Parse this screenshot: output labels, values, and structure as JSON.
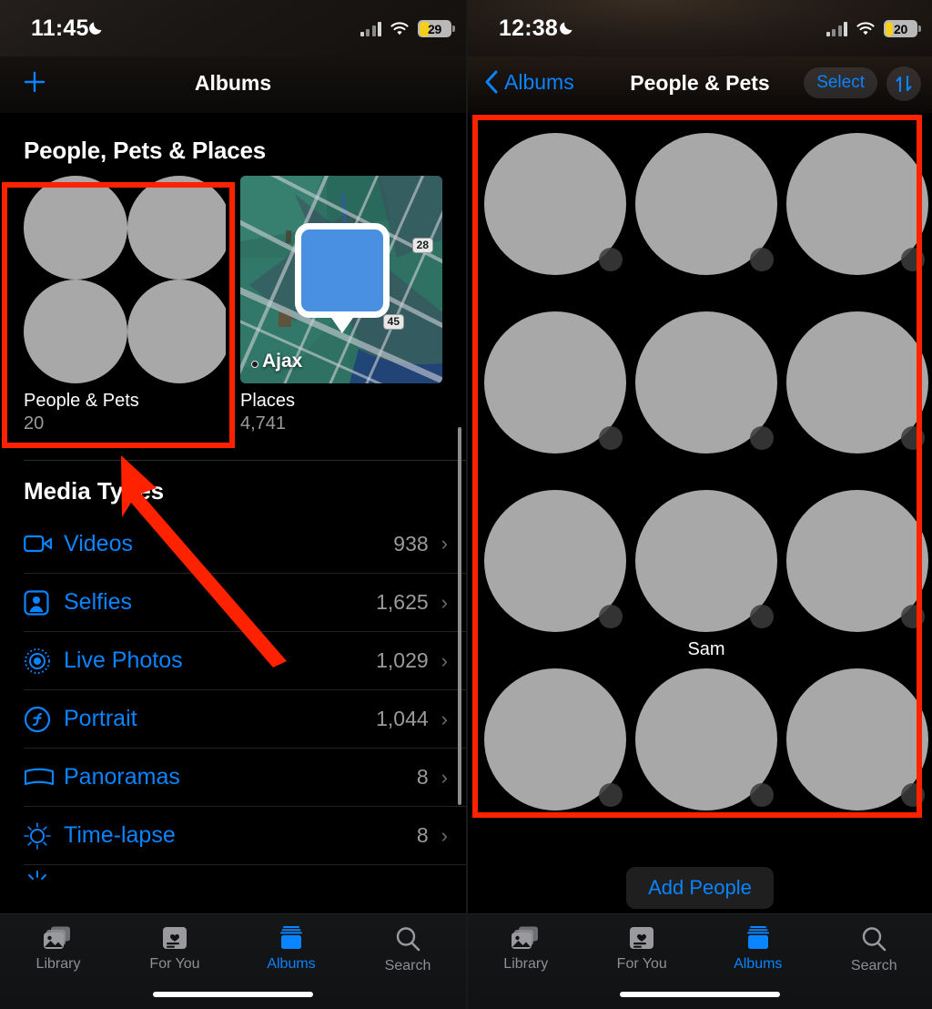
{
  "colors": {
    "accent_blue": "#0a84ff",
    "annotation_red": "#ff2200",
    "battery_yellow": "#f5cf1d",
    "background": "#000000"
  },
  "left_screen": {
    "status_bar": {
      "time": "11:45",
      "dnd_icon": "crescent-moon-icon",
      "battery_percent": "29",
      "wifi_icon": "wifi-icon",
      "cellular_icon": "cellular-bars-icon"
    },
    "nav": {
      "add_label": "+",
      "title": "Albums"
    },
    "section_people_places": {
      "heading": "People, Pets & Places",
      "cards": [
        {
          "name": "People & Pets",
          "count": "20",
          "art": "four-face-circles"
        },
        {
          "name": "Places",
          "count": "4,741",
          "art": "map-thumbnail"
        }
      ]
    },
    "map_thumb": {
      "city_label": "Ajax",
      "shield_1": "28",
      "shield_2": "45"
    },
    "section_media_types": {
      "heading": "Media Types",
      "rows": [
        {
          "icon": "video-camera-icon",
          "label": "Videos",
          "count": "938",
          "chevron": "›"
        },
        {
          "icon": "selfie-icon",
          "label": "Selfies",
          "count": "1,625",
          "chevron": "›"
        },
        {
          "icon": "live-photo-icon",
          "label": "Live Photos",
          "count": "1,029",
          "chevron": "›"
        },
        {
          "icon": "portrait-icon",
          "label": "Portrait",
          "count": "1,044",
          "chevron": "›"
        },
        {
          "icon": "panorama-icon",
          "label": "Panoramas",
          "count": "8",
          "chevron": "›"
        },
        {
          "icon": "timelapse-icon",
          "label": "Time-lapse",
          "count": "8",
          "chevron": "›"
        }
      ]
    },
    "tabs": [
      {
        "icon": "photo-library-icon",
        "label": "Library",
        "active": false
      },
      {
        "icon": "for-you-icon",
        "label": "For You",
        "active": false
      },
      {
        "icon": "albums-icon",
        "label": "Albums",
        "active": true
      },
      {
        "icon": "search-icon",
        "label": "Search",
        "active": false
      }
    ]
  },
  "right_screen": {
    "status_bar": {
      "time": "12:38",
      "dnd_icon": "crescent-moon-icon",
      "battery_percent": "20",
      "wifi_icon": "wifi-icon",
      "cellular_icon": "cellular-bars-icon"
    },
    "nav": {
      "back_label": "Albums",
      "title": "People & Pets",
      "select_label": "Select",
      "sort_icon": "sort-arrows-icon"
    },
    "people_grid": {
      "rows": 4,
      "columns": 3,
      "people": [
        {
          "name": ""
        },
        {
          "name": ""
        },
        {
          "name": ""
        },
        {
          "name": ""
        },
        {
          "name": ""
        },
        {
          "name": ""
        },
        {
          "name": ""
        },
        {
          "name": "Sam"
        },
        {
          "name": ""
        },
        {
          "name": ""
        },
        {
          "name": ""
        },
        {
          "name": ""
        }
      ]
    },
    "add_people_label": "Add People",
    "tabs": [
      {
        "icon": "photo-library-icon",
        "label": "Library",
        "active": false
      },
      {
        "icon": "for-you-icon",
        "label": "For You",
        "active": false
      },
      {
        "icon": "albums-icon",
        "label": "Albums",
        "active": true
      },
      {
        "icon": "search-icon",
        "label": "Search",
        "active": false
      }
    ]
  },
  "annotations": {
    "highlight_box_left": "people-and-pets-card",
    "highlight_box_right": "people-grid",
    "arrow": "points-to-people-and-pets-card"
  }
}
